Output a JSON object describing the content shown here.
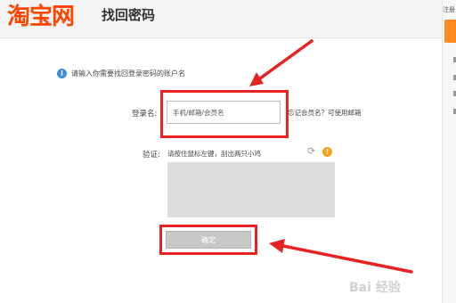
{
  "header": {
    "logo_text": "淘宝网",
    "page_title": "找回密码"
  },
  "right_panel": {
    "top_text": "注册"
  },
  "form": {
    "hint_text": "请输入你需要找回登录密码的账户名",
    "login_label": "登录名:",
    "username_placeholder": "手机/邮箱/会员名",
    "forgot_text": "忘记会员名？可使用邮箱",
    "verify_label": "验证:",
    "verify_hint": "请按住鼠标左键，刮出两只小鸡",
    "confirm_label": "确定"
  },
  "icons": {
    "info": "info-icon",
    "refresh": "refresh-icon",
    "help": "help-icon"
  },
  "annotation_color": "#e62222",
  "brand_color": "#ff4400",
  "watermark_text": "Bai 经验"
}
